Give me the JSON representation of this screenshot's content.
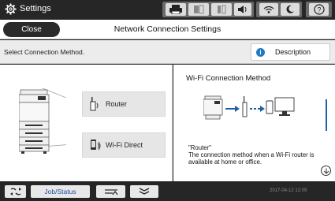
{
  "header": {
    "title": "Settings",
    "icons": [
      "gear-icon",
      "printer-icon",
      "copy-icon",
      "fax-icon",
      "volume-icon",
      "wifi-icon",
      "sleep-icon",
      "help-icon"
    ],
    "help_label": "?"
  },
  "titlebar": {
    "close_label": "Close",
    "page_title": "Network Connection Settings"
  },
  "subbar": {
    "select_label": "Select Connection Method.",
    "description_label": "Description",
    "description_icon": "i"
  },
  "options": [
    {
      "label": "Router",
      "icon": "router-icon"
    },
    {
      "label": "Wi-Fi Direct",
      "icon": "wifi-direct-icon"
    }
  ],
  "info": {
    "title": "Wi-Fi Connection Method",
    "text_quote": "\"Router\"",
    "text_body": "The connection method when a Wi-Fi router is available at home or office."
  },
  "footer": {
    "job_status_label": "Job/Status",
    "timestamp": "2017-04-12 12:09",
    "icons": [
      "network-status-icon",
      "job-status-button",
      "paper-setting-icon",
      "stack-icon"
    ]
  },
  "colors": {
    "accent": "#1f5fa8",
    "bar_bg": "#262626",
    "button_bg": "#e6e6e6"
  }
}
